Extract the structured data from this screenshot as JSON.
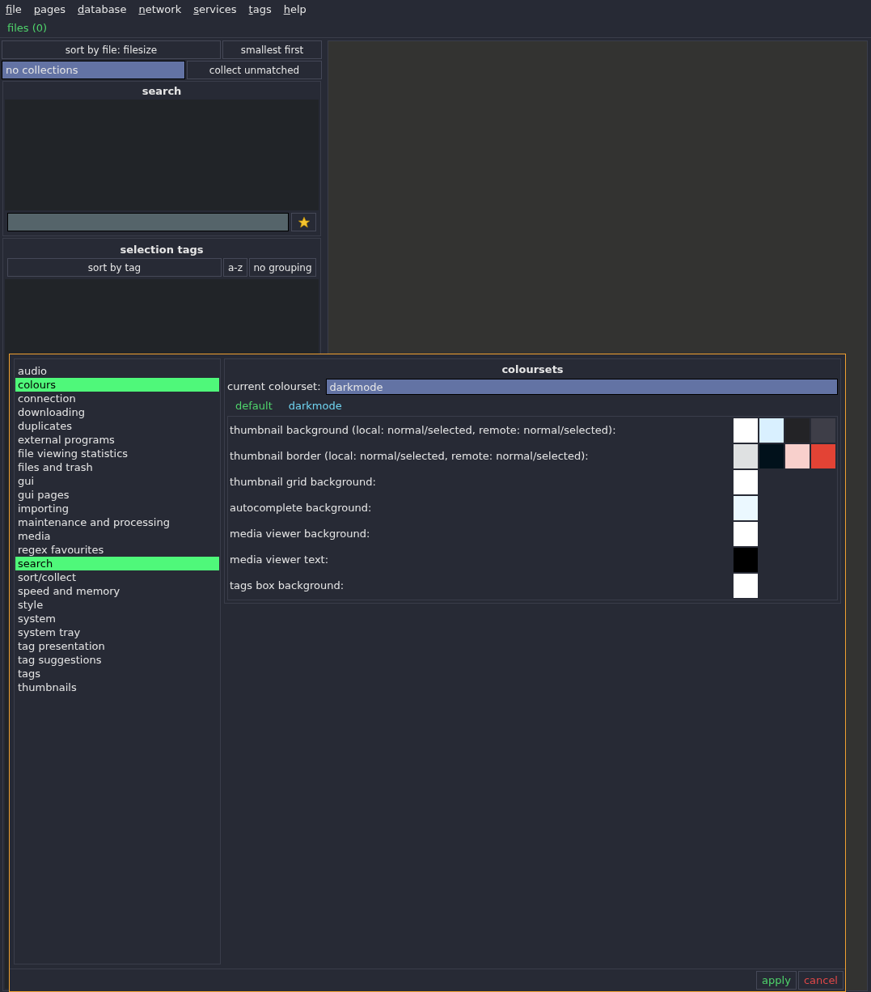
{
  "menu": [
    "file",
    "pages",
    "database",
    "network",
    "services",
    "tags",
    "help"
  ],
  "page_tab": {
    "label": "files (0)"
  },
  "sort": {
    "by": "sort by file: filesize",
    "order": "smallest first"
  },
  "collect": {
    "value": "no collections",
    "unmatched": "collect unmatched"
  },
  "search": {
    "title": "search"
  },
  "selection_tags": {
    "title": "selection tags",
    "sort": "sort by tag",
    "order": "a-z",
    "grouping": "no grouping"
  },
  "dialog": {
    "categories": [
      {
        "label": "audio",
        "selected": false
      },
      {
        "label": "colours",
        "selected": true
      },
      {
        "label": "connection",
        "selected": false
      },
      {
        "label": "downloading",
        "selected": false
      },
      {
        "label": "duplicates",
        "selected": false
      },
      {
        "label": "external programs",
        "selected": false
      },
      {
        "label": "file viewing statistics",
        "selected": false
      },
      {
        "label": "files and trash",
        "selected": false
      },
      {
        "label": "gui",
        "selected": false
      },
      {
        "label": "gui pages",
        "selected": false
      },
      {
        "label": "importing",
        "selected": false
      },
      {
        "label": "maintenance and processing",
        "selected": false
      },
      {
        "label": "media",
        "selected": false
      },
      {
        "label": "regex favourites",
        "selected": false
      },
      {
        "label": "search",
        "selected": true
      },
      {
        "label": "sort/collect",
        "selected": false
      },
      {
        "label": "speed and memory",
        "selected": false
      },
      {
        "label": "style",
        "selected": false
      },
      {
        "label": "system",
        "selected": false
      },
      {
        "label": "system tray",
        "selected": false
      },
      {
        "label": "tag presentation",
        "selected": false
      },
      {
        "label": "tag suggestions",
        "selected": false
      },
      {
        "label": "tags",
        "selected": false
      },
      {
        "label": "thumbnails",
        "selected": false
      }
    ],
    "coloursets": {
      "title": "coloursets",
      "current_label": "current colourset:",
      "current_value": "darkmode",
      "tabs": [
        {
          "label": "default",
          "selected": false
        },
        {
          "label": "darkmode",
          "selected": true
        }
      ],
      "rows": [
        {
          "label": "thumbnail background (local: normal/selected, remote: normal/selected):",
          "swatches": [
            {
              "color": "#ffffff"
            },
            {
              "color": "#d9f0ff"
            },
            {
              "color": "#232326"
            },
            {
              "color": "#3e3e48"
            }
          ]
        },
        {
          "label": "thumbnail border (local: normal/selected, remote: normal/selected):",
          "swatches": [
            {
              "color": "#dfe1e2"
            },
            {
              "color": "#01111b"
            },
            {
              "color": "#f8d0cc"
            },
            {
              "color": "#e34335"
            }
          ]
        },
        {
          "label": "thumbnail grid background:",
          "swatches": [
            {
              "color": "#ffffff"
            }
          ]
        },
        {
          "label": "autocomplete background:",
          "swatches": [
            {
              "color": "#ebf8ff"
            }
          ]
        },
        {
          "label": "media viewer background:",
          "swatches": [
            {
              "color": "#ffffff"
            }
          ]
        },
        {
          "label": "media viewer text:",
          "swatches": [
            {
              "color": "#000000"
            }
          ]
        },
        {
          "label": "tags box background:",
          "swatches": [
            {
              "color": "#ffffff"
            }
          ]
        }
      ]
    },
    "buttons": [
      {
        "label": "apply",
        "kind": "ok"
      },
      {
        "label": "cancel",
        "kind": "cancel"
      }
    ]
  }
}
